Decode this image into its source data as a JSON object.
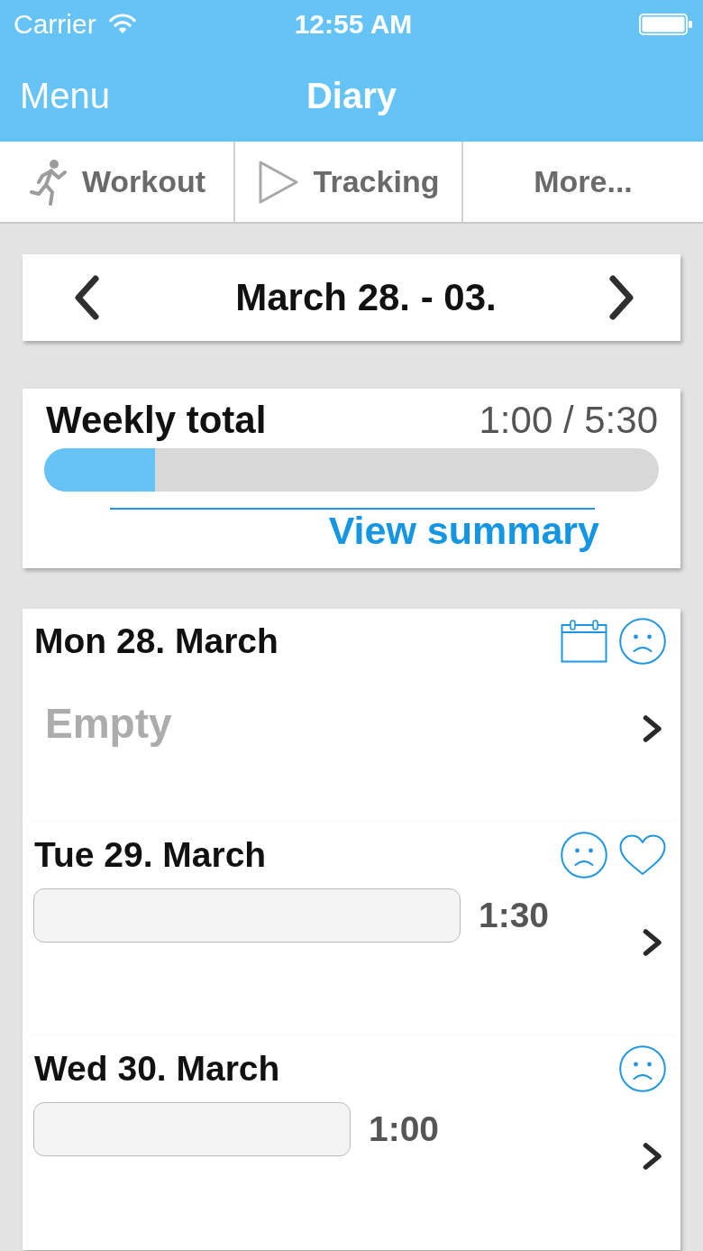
{
  "status_bar": {
    "carrier": "Carrier",
    "time": "12:55 AM"
  },
  "nav_bar": {
    "left_button": "Menu",
    "title": "Diary"
  },
  "tabs": [
    {
      "label": "Workout",
      "kind": "workout"
    },
    {
      "label": "Tracking",
      "kind": "tracking"
    },
    {
      "label": "More...",
      "kind": "more"
    }
  ],
  "week_nav": {
    "title": "March 28. - 03."
  },
  "weekly_total": {
    "label": "Weekly total",
    "reading": "1:00 / 5:30",
    "level": 0.18,
    "link": "View summary"
  },
  "days": [
    {
      "title": "Mon 28. March",
      "icons": [
        {
          "kind": "calendar"
        },
        {
          "kind": "mood"
        }
      ],
      "kind": "empty",
      "text": "Empty"
    },
    {
      "title": "Tue 29. March",
      "icons": [
        {
          "kind": "mood"
        },
        {
          "kind": "heart"
        }
      ],
      "kind": "entry",
      "text": "1:30"
    },
    {
      "title": "Wed 30. March",
      "icons": [
        {
          "kind": "mood"
        }
      ],
      "kind": "entry",
      "text": "1:00"
    }
  ]
}
